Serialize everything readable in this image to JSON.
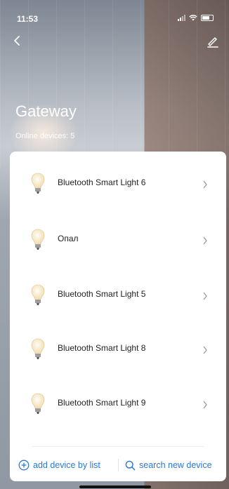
{
  "status_bar": {
    "time": "11:53"
  },
  "header": {
    "title": "Gateway",
    "subtitle": "Online devices: 5"
  },
  "devices": [
    {
      "name": "Bluetooth Smart Light 6"
    },
    {
      "name": "Опал"
    },
    {
      "name": "Bluetooth Smart Light 5"
    },
    {
      "name": "Bluetooth Smart Light 8"
    },
    {
      "name": "Bluetooth Smart Light 9"
    }
  ],
  "actions": {
    "add_label": "add device by list",
    "search_label": "search new device"
  },
  "colors": {
    "accent": "#2b78d8",
    "text": "#222222"
  },
  "icons": [
    "back-icon",
    "edit-icon",
    "bulb-icon",
    "chevron-right-icon",
    "add-circle-icon",
    "search-icon"
  ]
}
